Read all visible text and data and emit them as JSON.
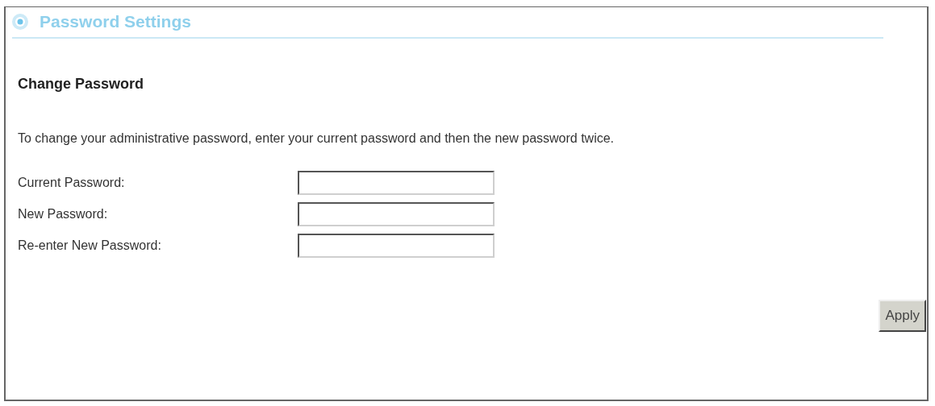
{
  "section": {
    "title": "Password Settings"
  },
  "heading": "Change Password",
  "instructions": "To change your administrative password, enter your current password and then the new password twice.",
  "fields": [
    {
      "label": "Current Password:"
    },
    {
      "label": "New Password:"
    },
    {
      "label": "Re-enter New Password:"
    }
  ],
  "buttons": [
    {
      "kind": "apply",
      "label": "Apply"
    }
  ]
}
